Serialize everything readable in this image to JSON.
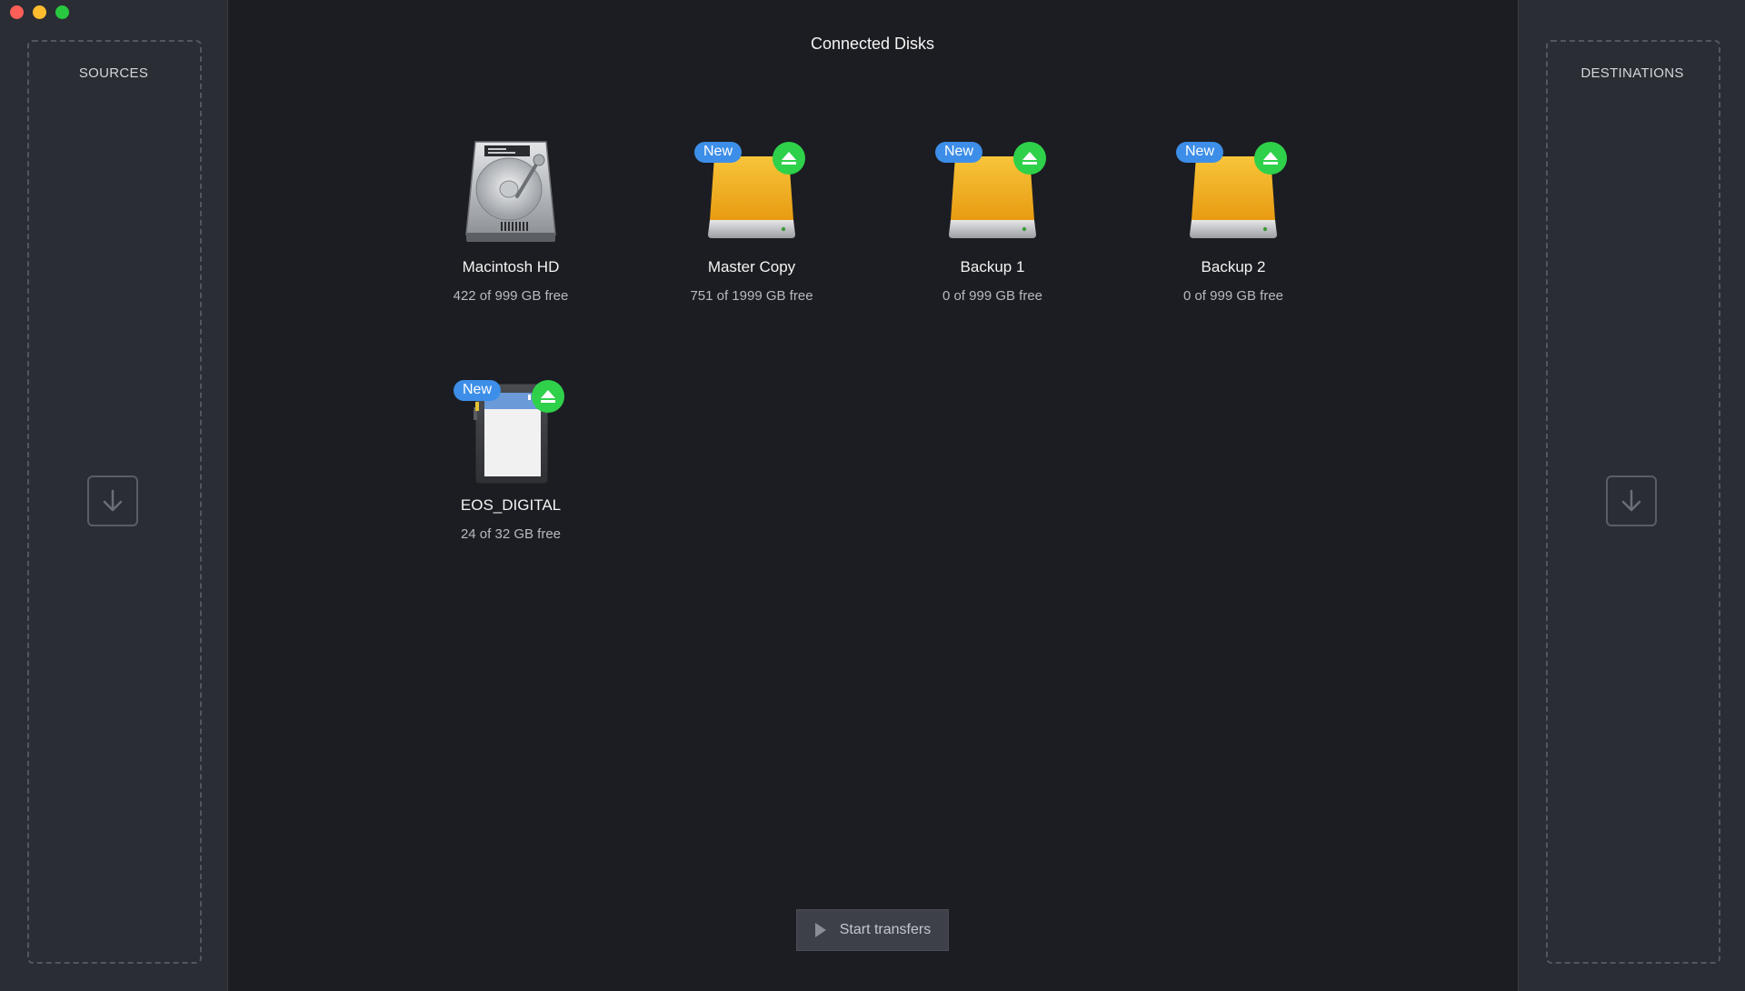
{
  "main": {
    "title": "Connected Disks",
    "start_label": "Start transfers"
  },
  "sources": {
    "title": "SOURCES"
  },
  "destinations": {
    "title": "DESTINATIONS"
  },
  "disks": [
    {
      "name": "Macintosh HD",
      "free": "422 of 999 GB free",
      "kind": "internal-hd",
      "is_new": false
    },
    {
      "name": "Master Copy",
      "free": "751 of 1999 GB free",
      "kind": "external-drive",
      "is_new": true,
      "badge": "New"
    },
    {
      "name": "Backup 1",
      "free": "0 of 999 GB free",
      "kind": "external-drive",
      "is_new": true,
      "badge": "New"
    },
    {
      "name": "Backup 2",
      "free": "0 of 999 GB free",
      "kind": "external-drive",
      "is_new": true,
      "badge": "New"
    },
    {
      "name": "EOS_DIGITAL",
      "free": "24 of 32 GB free",
      "kind": "sd-card",
      "is_new": true,
      "badge": "New"
    }
  ],
  "colors": {
    "badge": "#3d8ee8",
    "eject": "#2fd14a",
    "drive": "#f2b322",
    "background": "#1c1d22",
    "panel": "#2b2d34"
  },
  "icons": {
    "drop": "arrow-down-tray-icon",
    "eject": "eject-icon",
    "play": "play-icon"
  }
}
